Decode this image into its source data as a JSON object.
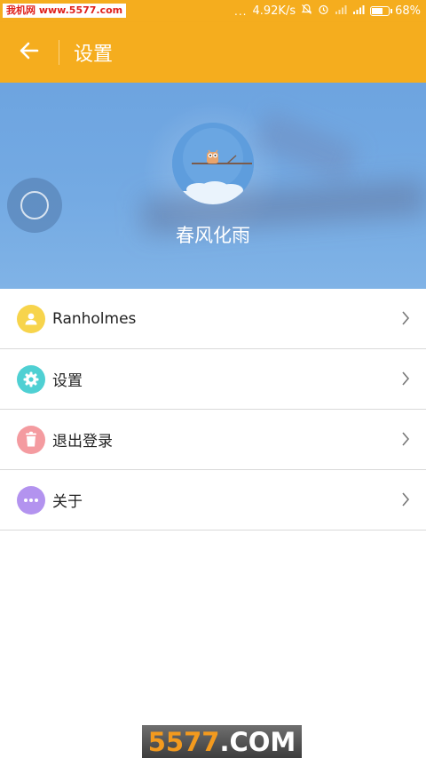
{
  "status_bar": {
    "watermark_badge": "我机网 www.5577.com",
    "dots": "...",
    "speed": "4.92K/s",
    "battery": "68%"
  },
  "app_bar": {
    "back_icon": "arrow-left-icon",
    "title": "设置"
  },
  "profile": {
    "name": "春风化雨",
    "avatar_icon": "owl-avatar"
  },
  "menu": {
    "items": [
      {
        "label": "Ranholmes",
        "icon": "user-icon",
        "color": "#f7d44c"
      },
      {
        "label": "设置",
        "icon": "gear-icon",
        "color": "#4fd0d3"
      },
      {
        "label": "退出登录",
        "icon": "trash-icon",
        "color": "#f49ba0"
      },
      {
        "label": "关于",
        "icon": "more-dots-icon",
        "color": "#b393ef"
      }
    ]
  },
  "watermark": {
    "number": "5577",
    "domain": ".COM"
  },
  "colors": {
    "accent": "#f5ad1e",
    "banner": "#74aae3"
  }
}
